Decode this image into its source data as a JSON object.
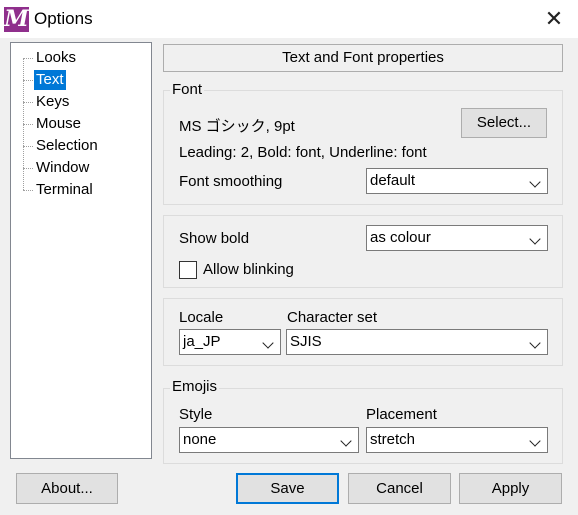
{
  "window": {
    "title": "Options",
    "app_icon_letter": "M"
  },
  "tree": {
    "items": [
      {
        "label": "Looks"
      },
      {
        "label": "Text",
        "selected": true
      },
      {
        "label": "Keys"
      },
      {
        "label": "Mouse"
      },
      {
        "label": "Selection"
      },
      {
        "label": "Window"
      },
      {
        "label": "Terminal"
      }
    ]
  },
  "panel_title": "Text and Font properties",
  "font_group": {
    "label": "Font",
    "font_name": "MS ゴシック, 9pt",
    "select_button": "Select...",
    "details": "Leading: 2, Bold: font, Underline: font",
    "smoothing_label": "Font smoothing",
    "smoothing_value": "default"
  },
  "bold_group": {
    "show_bold_label": "Show bold",
    "show_bold_value": "as colour",
    "allow_blinking_label": "Allow blinking",
    "allow_blinking_checked": false
  },
  "locale_group": {
    "locale_label": "Locale",
    "locale_value": "ja_JP",
    "charset_label": "Character set",
    "charset_value": "SJIS"
  },
  "emojis_group": {
    "label": "Emojis",
    "style_label": "Style",
    "style_value": "none",
    "placement_label": "Placement",
    "placement_value": "stretch"
  },
  "buttons": {
    "about": "About...",
    "save": "Save",
    "cancel": "Cancel",
    "apply": "Apply"
  },
  "colors": {
    "selection": "#0078d7",
    "app_icon": "#8f2f8c",
    "default_button_border": "#0078d7"
  }
}
